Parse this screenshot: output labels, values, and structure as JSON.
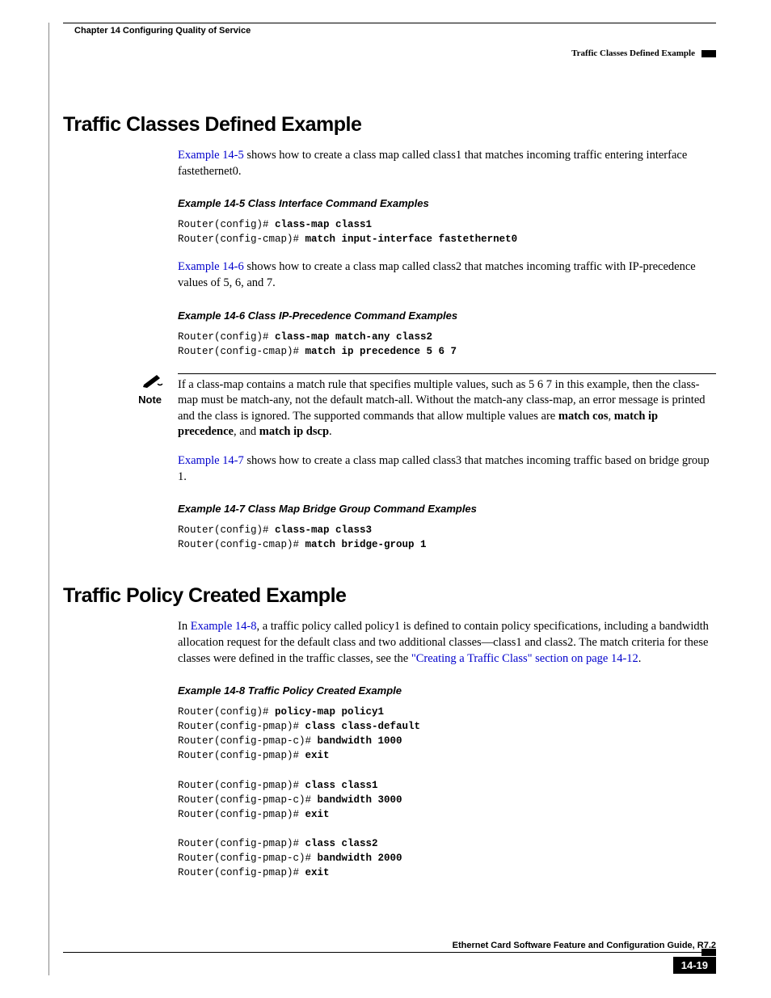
{
  "header": {
    "chapter": "Chapter 14 Configuring Quality of Service",
    "section_label": "Traffic Classes Defined Example"
  },
  "s1": {
    "title": "Traffic Classes Defined Example",
    "p1_link": "Example 14-5",
    "p1_rest": " shows how to create a class map called class1 that matches incoming traffic entering interface fastethernet0.",
    "ex5_title": "Example 14-5   Class Interface Command Examples",
    "ex5_l1a": "Router(config)# ",
    "ex5_l1b": "class-map class1",
    "ex5_l2a": "Router(config-cmap)# ",
    "ex5_l2b": "match input-interface fastethernet0",
    "p2_link": "Example 14-6",
    "p2_rest": " shows how to create a class map called class2 that matches incoming traffic with IP-precedence values of 5, 6, and 7.",
    "ex6_title": "Example 14-6   Class IP-Precedence Command Examples",
    "ex6_l1a": "Router(config)# ",
    "ex6_l1b": "class-map match-any class2",
    "ex6_l2a": "Router(config-cmap)# ",
    "ex6_l2b": "match ip precedence 5 6 7",
    "note_label": "Note",
    "note_t1": "If a class-map contains a match rule that specifies multiple values, such as 5 6 7 in this example, then the class-map must be match-any, not the default match-all. Without the match-any class-map, an error message is printed and the class is ignored. The supported commands that allow multiple values are ",
    "note_b1": "match cos",
    "note_t2": ", ",
    "note_b2": "match ip precedence",
    "note_t3": ", and ",
    "note_b3": "match ip dscp",
    "note_t4": ".",
    "p3_link": "Example 14-7",
    "p3_rest": " shows how to create a class map called class3 that matches incoming traffic based on bridge group 1.",
    "ex7_title": "Example 14-7   Class Map Bridge Group Command Examples",
    "ex7_l1a": "Router(config)# ",
    "ex7_l1b": "class-map class3",
    "ex7_l2a": "Router(config-cmap)# ",
    "ex7_l2b": "match bridge-group 1"
  },
  "s2": {
    "title": "Traffic Policy Created Example",
    "p1_t1": "In ",
    "p1_link1": "Example 14-8",
    "p1_t2": ", a traffic policy called policy1 is defined to contain policy specifications, including a bandwidth allocation request for the default class and two additional classes—class1 and class2. The match criteria for these classes were defined in the traffic classes, see the ",
    "p1_link2": "\"Creating a Traffic Class\" section on page 14-12",
    "p1_t3": ".",
    "ex8_title": "Example 14-8   Traffic Policy Created Example",
    "ex8_l1a": "Router(config)# ",
    "ex8_l1b": "policy-map policy1",
    "ex8_l2a": "Router(config-pmap)# ",
    "ex8_l2b": "class class-default",
    "ex8_l3a": "Router(config-pmap-c)# ",
    "ex8_l3b": "bandwidth 1000",
    "ex8_l4a": "Router(config-pmap)# ",
    "ex8_l4b": "exit",
    "ex8_l5a": "Router(config-pmap)# ",
    "ex8_l5b": "class class1",
    "ex8_l6a": "Router(config-pmap-c)# ",
    "ex8_l6b": "bandwidth 3000",
    "ex8_l7a": "Router(config-pmap)# ",
    "ex8_l7b": "exit",
    "ex8_l8a": "Router(config-pmap)# ",
    "ex8_l8b": "class class2",
    "ex8_l9a": "Router(config-pmap-c)# ",
    "ex8_l9b": "bandwidth 2000",
    "ex8_l10a": "Router(config-pmap)# ",
    "ex8_l10b": "exit"
  },
  "footer": {
    "guide": "Ethernet Card Software Feature and Configuration Guide, R7.2",
    "pagenum": "14-19"
  }
}
